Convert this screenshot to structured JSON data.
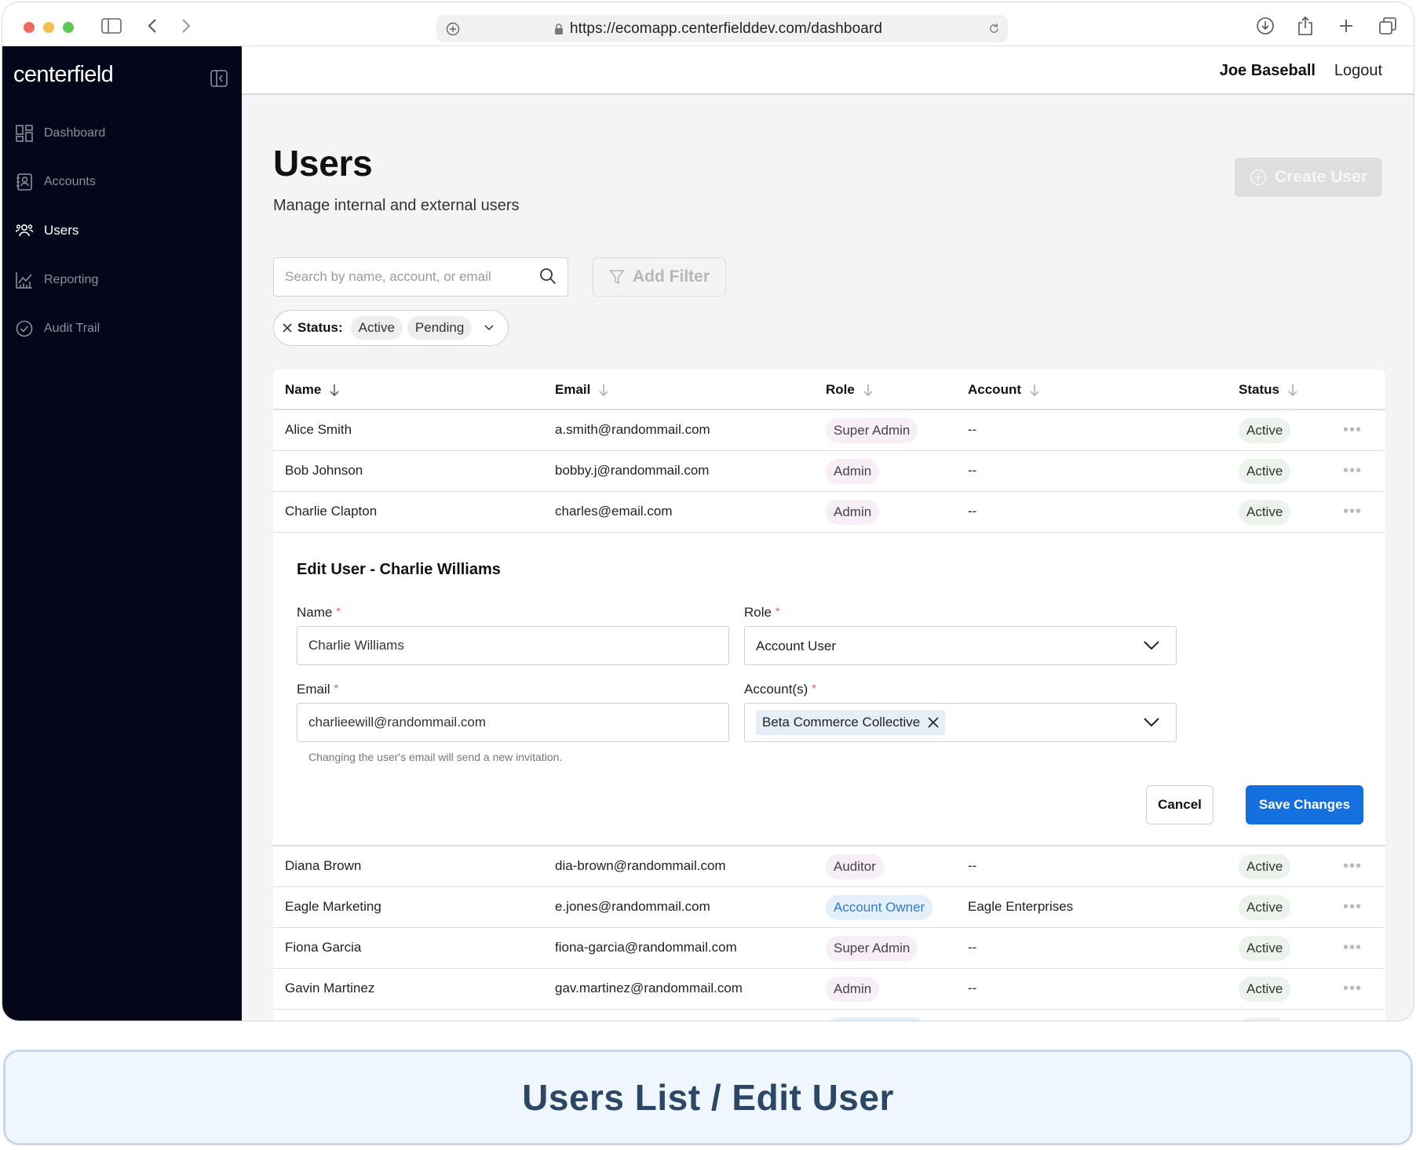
{
  "browser": {
    "url": "https://ecomapp.centerfielddev.com/dashboard"
  },
  "sidebar": {
    "logo": "centerfield",
    "items": [
      {
        "label": "Dashboard",
        "icon": "dashboard-icon"
      },
      {
        "label": "Accounts",
        "icon": "accounts-icon"
      },
      {
        "label": "Users",
        "icon": "users-icon",
        "active": true
      },
      {
        "label": "Reporting",
        "icon": "reporting-icon"
      },
      {
        "label": "Audit Trail",
        "icon": "audit-trail-icon"
      }
    ]
  },
  "topbar": {
    "user_name": "Joe Baseball",
    "logout": "Logout"
  },
  "page": {
    "title": "Users",
    "subtitle": "Manage internal and external users",
    "create_button": "Create User"
  },
  "filters": {
    "search_placeholder": "Search by name, account, or email",
    "add_filter": "Add Filter",
    "status_label": "Status:",
    "status_values": [
      "Active",
      "Pending"
    ]
  },
  "table": {
    "headers": [
      "Name",
      "Email",
      "Role",
      "Account",
      "Status"
    ],
    "rows_top": [
      {
        "name": "Alice Smith",
        "email": "a.smith@randommail.com",
        "role": "Super Admin",
        "account": "--",
        "status": "Active"
      },
      {
        "name": "Bob Johnson",
        "email": "bobby.j@randommail.com",
        "role": "Admin",
        "account": "--",
        "status": "Active"
      },
      {
        "name": "Charlie Clapton",
        "email": "charles@email.com",
        "role": "Admin",
        "account": "--",
        "status": "Active"
      }
    ],
    "rows_bottom": [
      {
        "name": "Diana Brown",
        "email": "dia-brown@randommail.com",
        "role": "Auditor",
        "account": "--",
        "status": "Active"
      },
      {
        "name": "Eagle Marketing",
        "email": "e.jones@randommail.com",
        "role": "Account Owner",
        "account": "Eagle Enterprises",
        "status": "Active"
      },
      {
        "name": "Fiona Garcia",
        "email": "fiona-garcia@randommail.com",
        "role": "Super Admin",
        "account": "--",
        "status": "Active"
      },
      {
        "name": "Gavin Martinez",
        "email": "gav.martinez@randommail.com",
        "role": "Admin",
        "account": "--",
        "status": "Active"
      }
    ]
  },
  "edit_user": {
    "heading": "Edit User - Charlie Williams",
    "name_label": "Name",
    "name_value": "Charlie Williams",
    "role_label": "Role",
    "role_value": "Account User",
    "email_label": "Email",
    "email_value": "charlieewill@randommail.com",
    "email_hint": "Changing the user's email will send a new invitation.",
    "accounts_label": "Account(s)",
    "accounts_values": [
      "Beta Commerce Collective"
    ],
    "required_mark": "*",
    "cancel": "Cancel",
    "save": "Save Changes"
  },
  "caption": "Users List / Edit User",
  "colors": {
    "sidebar_bg": "#05061a",
    "primary": "#1570df",
    "role_blue": "#2a7dd0"
  }
}
